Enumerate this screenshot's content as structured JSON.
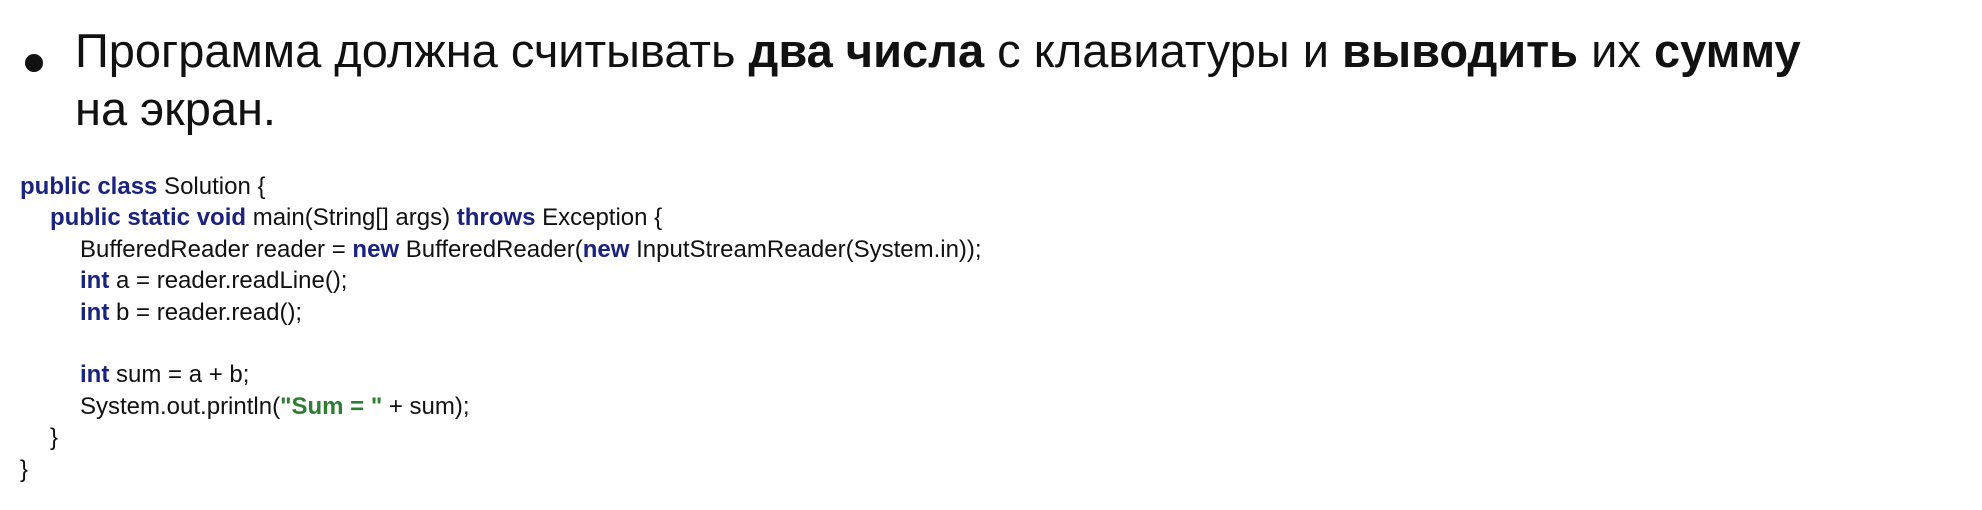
{
  "bullet": {
    "t1": "Программа должна считывать ",
    "b1": "два числа",
    "t2": " с клавиатуры и ",
    "b2": "выводить",
    "t3": " их ",
    "b3": "сумму",
    "t4": "на экран."
  },
  "code": {
    "l1_kw": "public class",
    "l1_rest": " Solution {",
    "l2_kw1": "public static void",
    "l2_mid": " main(String[] args) ",
    "l2_kw2": "throws",
    "l2_rest": " Exception {",
    "l3_a": "BufferedReader reader = ",
    "l3_kw1": "new",
    "l3_b": " BufferedReader(",
    "l3_kw2": "new",
    "l3_c": " InputStreamReader(System.in));",
    "l4_kw": "int",
    "l4_rest": " a = reader.readLine();",
    "l5_kw": "int",
    "l5_rest": " b = reader.read();",
    "l7_kw": "int",
    "l7_rest": " sum = a + b;",
    "l8_a": "System.out.println(",
    "l8_str": "\"Sum = \"",
    "l8_b": " + sum);",
    "l9": "}",
    "l10": "}"
  }
}
